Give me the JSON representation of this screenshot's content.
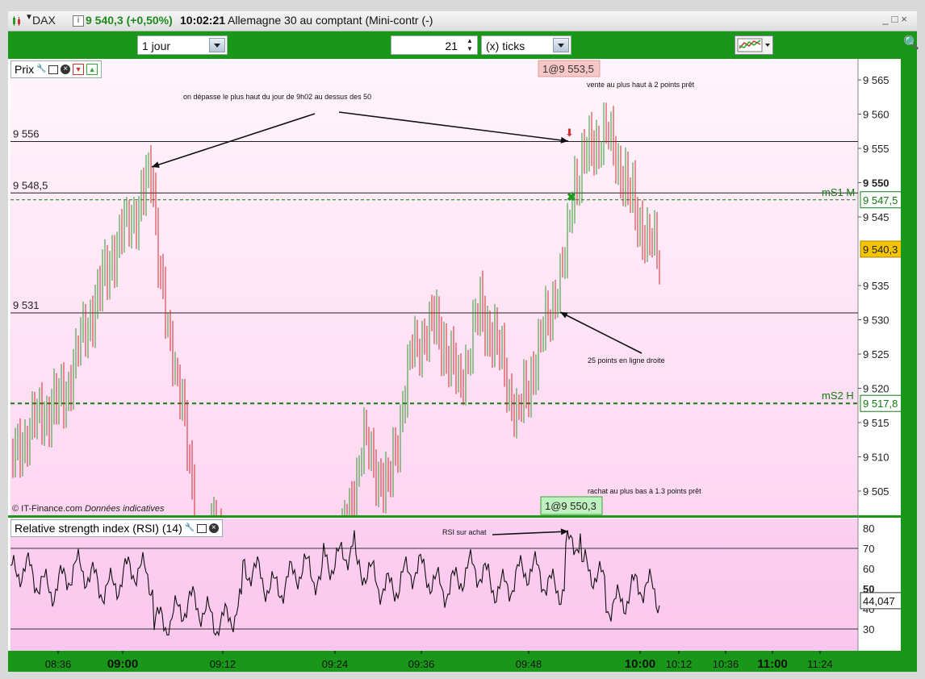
{
  "titlebar": {
    "symbol": "DAX",
    "info_glyph": "i",
    "price_change": "9 540,3 (+0,50%)",
    "time": "10:02:21",
    "description": "Allemagne 30 au comptant (Mini-contr (-)",
    "window_buttons": "_□×"
  },
  "toolbar": {
    "period": "1 jour",
    "tick_count": "21",
    "tick_unit": "(x) ticks"
  },
  "price_panel": {
    "label": "Prix",
    "copyright": "© IT-Finance.com",
    "disclaimer": "Données indicatives",
    "y_ticks": [
      "9 565",
      "9 560",
      "9 555",
      "9 550",
      "9 545",
      "9 540,3",
      "9 535",
      "9 530",
      "9 525",
      "9 520",
      "9 515",
      "9 510",
      "9 505"
    ],
    "current_price_label": "9 540,3",
    "ms1_label": "mS1 M",
    "ms1_value": "9 547,5",
    "ms2_label": "mS2 H",
    "ms2_value": "9 517,8",
    "level_labels": [
      "9 556",
      "9 548,5",
      "9 531"
    ],
    "order_sell": "1@9 553,5",
    "order_buy": "1@9 550,3",
    "annotations": [
      "on dépasse le plus haut du jour de 9h02 au dessus des 50",
      "vente au plus haut à 2 points prêt",
      "25 points en ligne droite",
      "rachat au plus bas à 1.3 points prêt"
    ]
  },
  "rsi_panel": {
    "label": "Relative strength index (RSI) (14)",
    "y_ticks": [
      "80",
      "70",
      "60",
      "50",
      "40",
      "30"
    ],
    "current_value": "44,047",
    "annotation": "RSI sur achat"
  },
  "time_axis": [
    "08:36",
    "09:00",
    "09:12",
    "09:24",
    "09:36",
    "09:48",
    "10:00",
    "10:12",
    "10:36",
    "11:00",
    "11:24"
  ],
  "colors": {
    "frame_green": "#199719",
    "up_candle": "#2e9a2e",
    "down_candle": "#d02a2a",
    "ms_line": "#107c10"
  }
}
